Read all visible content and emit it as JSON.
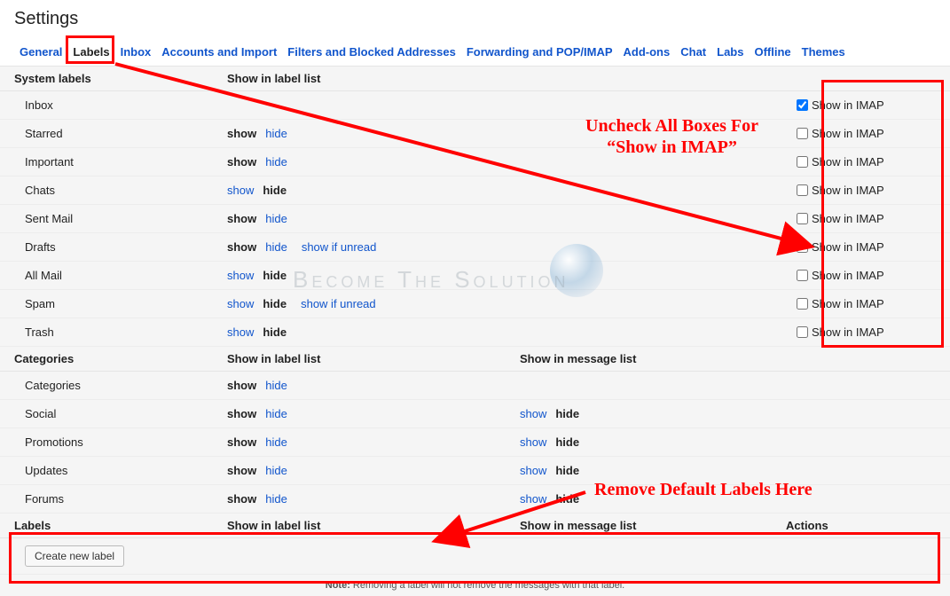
{
  "page_title": "Settings",
  "tabs": [
    {
      "label": "General",
      "active": false
    },
    {
      "label": "Labels",
      "active": true
    },
    {
      "label": "Inbox",
      "active": false
    },
    {
      "label": "Accounts and Import",
      "active": false
    },
    {
      "label": "Filters and Blocked Addresses",
      "active": false
    },
    {
      "label": "Forwarding and POP/IMAP",
      "active": false
    },
    {
      "label": "Add-ons",
      "active": false
    },
    {
      "label": "Chat",
      "active": false
    },
    {
      "label": "Labs",
      "active": false
    },
    {
      "label": "Offline",
      "active": false
    },
    {
      "label": "Themes",
      "active": false
    }
  ],
  "columns": {
    "system_name": "System labels",
    "label_list": "Show in label list",
    "categories_name": "Categories",
    "message_list": "Show in message list",
    "labels_name": "Labels",
    "actions": "Actions"
  },
  "toggle_words": {
    "show": "show",
    "hide": "hide",
    "show_if_unread": "show if unread"
  },
  "imap_label": "Show in IMAP",
  "system_labels": [
    {
      "name": "Inbox",
      "shown": null,
      "extra": null,
      "imap_checked": true
    },
    {
      "name": "Starred",
      "shown": true,
      "extra": null,
      "imap_checked": false
    },
    {
      "name": "Important",
      "shown": true,
      "extra": null,
      "imap_checked": false
    },
    {
      "name": "Chats",
      "shown": false,
      "extra": null,
      "imap_checked": false
    },
    {
      "name": "Sent Mail",
      "shown": true,
      "extra": null,
      "imap_checked": false
    },
    {
      "name": "Drafts",
      "shown": true,
      "extra": "show_if_unread",
      "imap_checked": false
    },
    {
      "name": "All Mail",
      "shown": false,
      "extra": null,
      "imap_checked": false
    },
    {
      "name": "Spam",
      "shown": false,
      "extra": "show_if_unread",
      "imap_checked": false
    },
    {
      "name": "Trash",
      "shown": false,
      "extra": null,
      "imap_checked": false
    }
  ],
  "categories": [
    {
      "name": "Categories",
      "label_shown": true,
      "msg_shown": null
    },
    {
      "name": "Social",
      "label_shown": true,
      "msg_shown": false
    },
    {
      "name": "Promotions",
      "label_shown": true,
      "msg_shown": false
    },
    {
      "name": "Updates",
      "label_shown": true,
      "msg_shown": false
    },
    {
      "name": "Forums",
      "label_shown": true,
      "msg_shown": false
    }
  ],
  "labels_section": {
    "create_button": "Create new label"
  },
  "note": {
    "prefix": "Note:",
    "text": " Removing a label will not remove the messages with that label."
  },
  "annotations": {
    "imap_text": "Uncheck All Boxes For\n“Show in IMAP”",
    "remove_text": "Remove Default Labels Here"
  },
  "watermark": "Become The Solution"
}
